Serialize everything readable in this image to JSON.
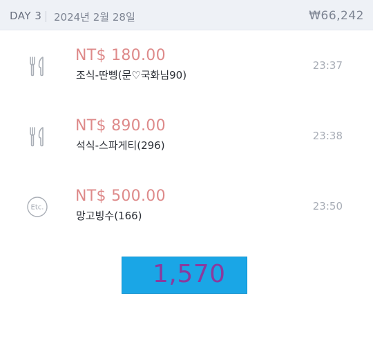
{
  "header": {
    "day_label": "DAY 3",
    "date": "2024년 2월 28일",
    "total": "₩66,242"
  },
  "expenses": [
    {
      "icon": "fork-knife-icon",
      "amount": "NT$ 180.00",
      "memo": "조식-딴삥(문♡국화님90)",
      "time": "23:37"
    },
    {
      "icon": "fork-knife-icon",
      "amount": "NT$ 890.00",
      "memo": "석식-스파게티(296)",
      "time": "23:38"
    },
    {
      "icon": "etc-icon",
      "icon_text": "Etc.",
      "amount": "NT$ 500.00",
      "memo": "망고빙수(166)",
      "time": "23:50"
    }
  ],
  "sum_overlay": {
    "value": "1,570"
  },
  "colors": {
    "header_bg": "#eef1f6",
    "amount": "#de8a8a",
    "icon": "#a9aeb6",
    "time": "#a8adb6",
    "sum_box": "#1aa6e6",
    "sum_text": "#8a3a9e"
  }
}
